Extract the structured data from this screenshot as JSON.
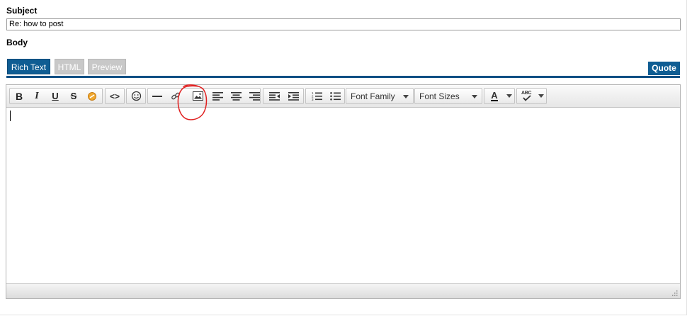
{
  "form": {
    "subject_label": "Subject",
    "subject_value": "Re: how to post",
    "body_label": "Body"
  },
  "tabs": [
    {
      "label": "Rich Text",
      "active": true
    },
    {
      "label": "HTML",
      "active": false
    },
    {
      "label": "Preview",
      "active": false
    }
  ],
  "quote_label": "Quote",
  "toolbar": {
    "buttons": [
      "bold-icon",
      "italic-icon",
      "underline-icon",
      "strikethrough-icon",
      "clear-formatting-icon",
      "code-icon",
      "emoticon-icon",
      "horizontal-rule-icon",
      "link-icon",
      "image-icon",
      "align-left-icon",
      "align-center-icon",
      "align-right-icon",
      "outdent-icon",
      "indent-icon",
      "numbered-list-icon",
      "bulleted-list-icon",
      "font-color-icon",
      "spellcheck-icon"
    ],
    "font_family": "Font Family",
    "font_sizes": "Font Sizes",
    "font_color_letter": "A",
    "spellcheck_text": "ABC"
  },
  "colors": {
    "accent": "#0f5d93",
    "inactive_tab": "#c8c8c8",
    "annotation": "#e02020"
  }
}
